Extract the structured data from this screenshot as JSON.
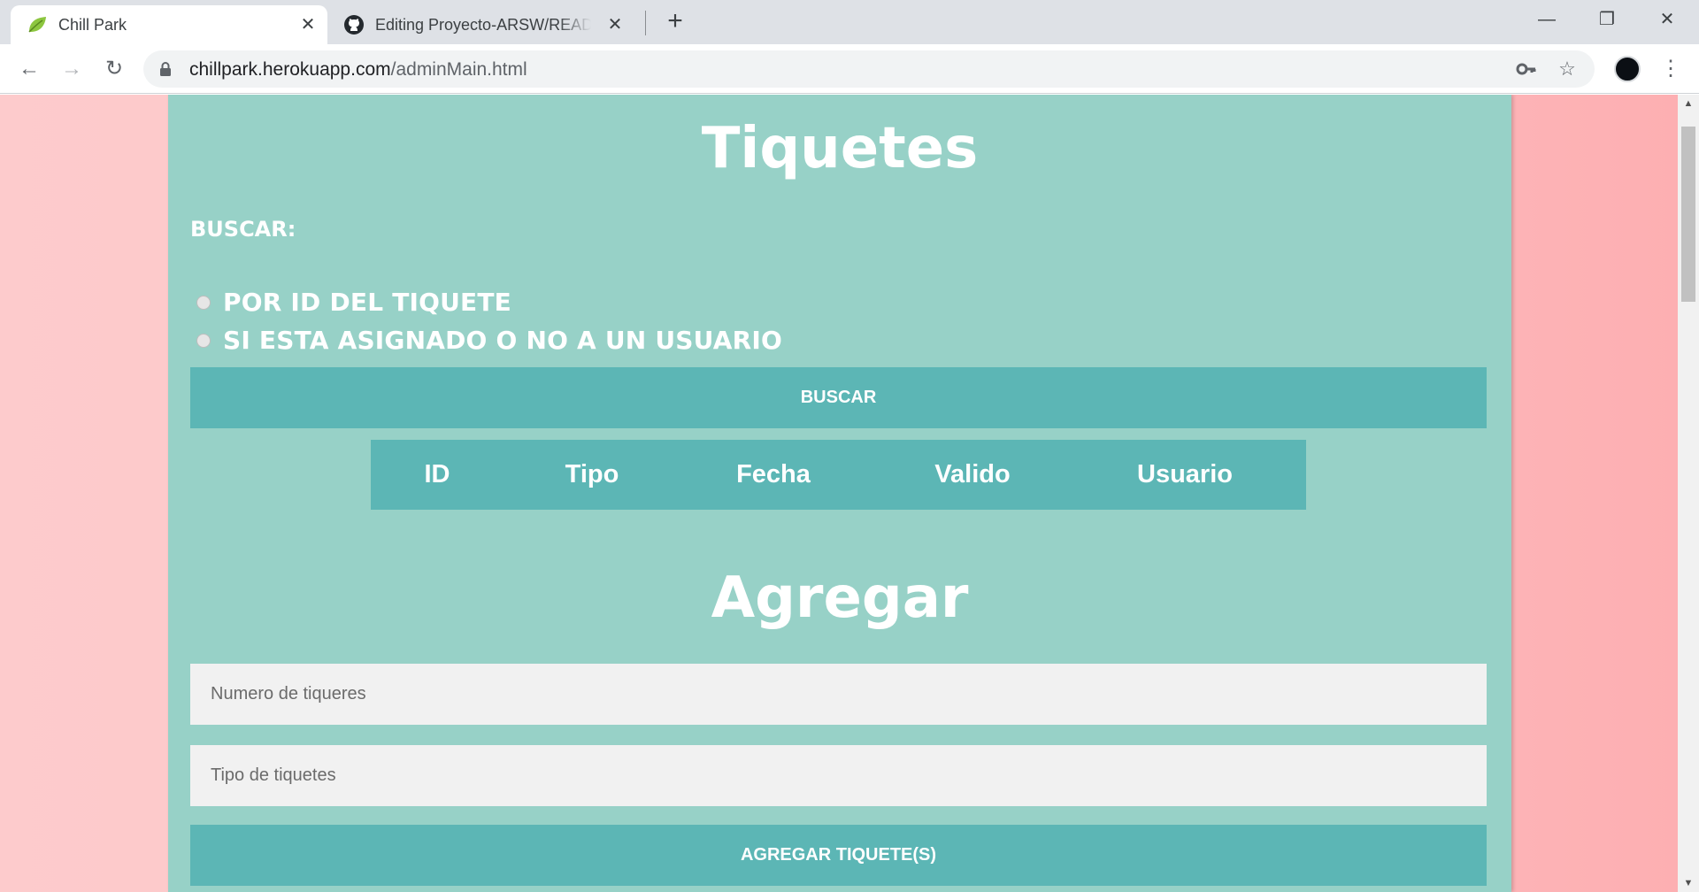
{
  "browser": {
    "tabs": [
      {
        "title": "Chill Park",
        "active": true,
        "favicon": "leaf-icon"
      },
      {
        "title": "Editing Proyecto-ARSW/README.md",
        "active": false,
        "favicon": "github-icon"
      }
    ],
    "new_tab": "+",
    "url": {
      "host": "chillpark.herokuapp.com",
      "path": "/adminMain.html"
    }
  },
  "page": {
    "tickets_title": "Tiquetes",
    "search_label": "BUSCAR:",
    "search_options": [
      "POR ID DEL TIQUETE",
      "SI ESTA ASIGNADO O NO A UN USUARIO"
    ],
    "search_button": "BUSCAR",
    "table_headers": [
      "ID",
      "Tipo",
      "Fecha",
      "Valido",
      "Usuario"
    ],
    "add_title": "Agregar",
    "add_inputs": {
      "count_placeholder": "Numero de tiqueres",
      "type_placeholder": "Tipo de tiquetes"
    },
    "add_button": "AGREGAR TIQUETE(S)"
  },
  "colors": {
    "card": "#97d1c7",
    "accent": "#5cb6b5",
    "background": "#fdc4c6"
  }
}
